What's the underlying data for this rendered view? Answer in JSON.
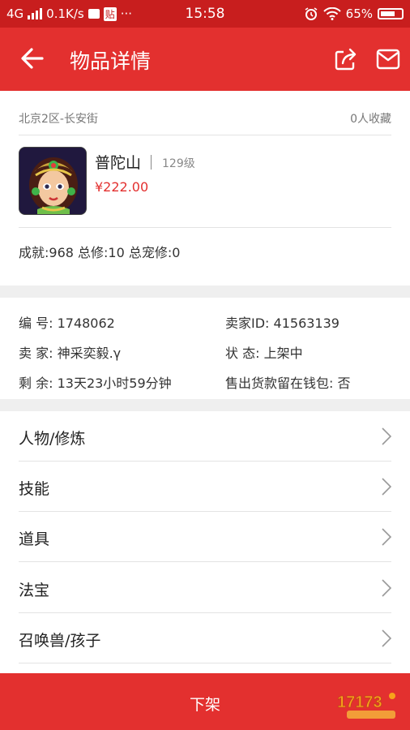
{
  "status_bar": {
    "network": "4G",
    "speed": "0.1K/s",
    "app_badge": "贴",
    "dots": "···",
    "time": "15:58",
    "battery": "65%"
  },
  "header": {
    "title": "物品详情",
    "icons": [
      "back-arrow-icon",
      "share-icon",
      "mail-icon"
    ]
  },
  "item": {
    "location": "北京2区-长安街",
    "favorites": "0人收藏",
    "character_name": "普陀山",
    "level": "129级",
    "price": "¥222.00",
    "achievements": "成就:968 总修:10 总宠修:0"
  },
  "details": {
    "number_label": "编  号:",
    "number_value": "1748062",
    "seller_id_label": "卖家ID:",
    "seller_id_value": "41563139",
    "seller_label": "卖  家:",
    "seller_value": "神采奕毅.γ",
    "status_label": "状  态:",
    "status_value": "上架中",
    "remaining_label": "剩  余:",
    "remaining_value": "13天23小时59分钟",
    "wallet_label": "售出货款留在钱包:",
    "wallet_value": "否"
  },
  "list": [
    {
      "label": "人物/修炼"
    },
    {
      "label": "技能"
    },
    {
      "label": "道具"
    },
    {
      "label": "法宝"
    },
    {
      "label": "召唤兽/孩子"
    }
  ],
  "bottom_button": {
    "label": "下架"
  },
  "colors": {
    "brand_red": "#e3302f",
    "status_bar_red": "#c81e1e",
    "price_red": "#e3302f"
  }
}
